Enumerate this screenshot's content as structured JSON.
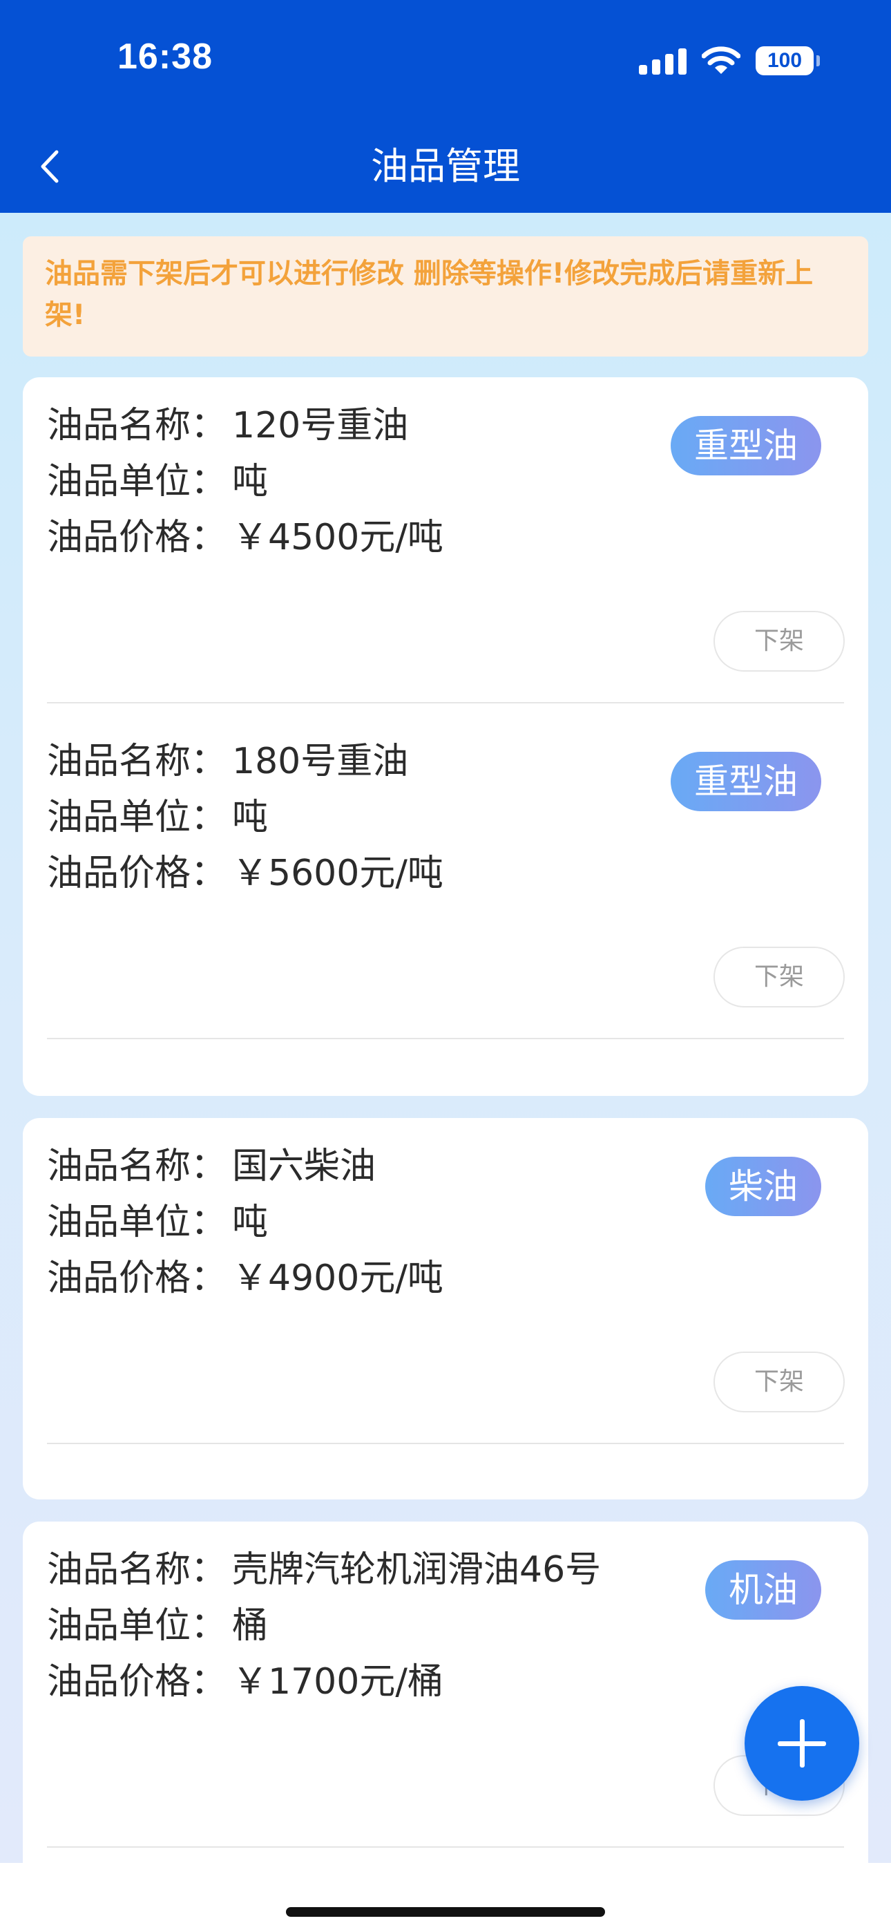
{
  "status_bar": {
    "time": "16:38",
    "battery": "100",
    "signal_icon": "signal-icon",
    "wifi_icon": "wifi-icon"
  },
  "header": {
    "title": "油品管理",
    "back_icon": "chevron-left-icon"
  },
  "notice": {
    "text": "油品需下架后才可以进行修改 删除等操作!修改完成后请重新上架!"
  },
  "labels": {
    "name": "油品名称：",
    "unit": "油品单位：",
    "price": "油品价格："
  },
  "cards": [
    {
      "items": [
        {
          "name": "120号重油",
          "unit": "吨",
          "price": "￥4500元/吨",
          "tag": "重型油",
          "action": "下架"
        },
        {
          "name": "180号重油",
          "unit": "吨",
          "price": "￥5600元/吨",
          "tag": "重型油",
          "action": "下架"
        }
      ]
    },
    {
      "items": [
        {
          "name": "国六柴油",
          "unit": "吨",
          "price": "￥4900元/吨",
          "tag": "柴油",
          "action": "下架"
        }
      ]
    },
    {
      "items": [
        {
          "name": "壳牌汽轮机润滑油46号",
          "unit": "桶",
          "price": "￥1700元/桶",
          "tag": "机油",
          "action": "下架"
        }
      ]
    }
  ],
  "fab": {
    "icon": "plus-icon"
  },
  "colors": {
    "header": "#0551d4",
    "notice_text": "#f3a23b",
    "notice_bg": "#fcefe3",
    "fab": "#1672ef"
  }
}
